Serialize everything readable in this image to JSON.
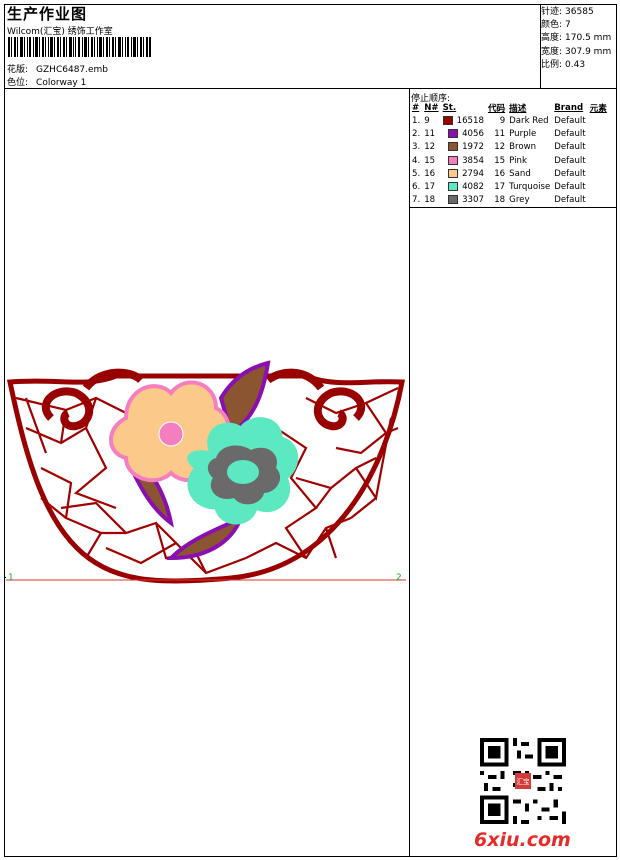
{
  "header": {
    "title": "生产作业图",
    "studio": "Wilcom(汇宝) 绣饰工作室",
    "pattern_label": "花版:",
    "pattern_value": "GZHC6487.emb",
    "colorway_label": "色位:",
    "colorway_value": "Colorway 1"
  },
  "stats": {
    "stitches_label": "针迹:",
    "stitches_value": "36585",
    "colors_label": "颜色:",
    "colors_value": "7",
    "height_label": "高度:",
    "height_value": "170.5 mm",
    "width_label": "宽度:",
    "width_value": "307.9 mm",
    "ratio_label": "比例:",
    "ratio_value": "0.43"
  },
  "stop_sequence": {
    "title": "停止顺序:",
    "headers": [
      "#",
      "N#",
      "St.",
      "代码",
      "描述",
      "Brand",
      "元素"
    ],
    "rows": [
      {
        "index": "1.",
        "n": "9",
        "color": "#990000",
        "st": "16518",
        "code": "9",
        "desc": "Dark Red",
        "brand": "Default"
      },
      {
        "index": "2.",
        "n": "11",
        "color": "#8a0fb0",
        "st": "4056",
        "code": "11",
        "desc": "Purple",
        "brand": "Default"
      },
      {
        "index": "3.",
        "n": "12",
        "color": "#8a5530",
        "st": "1972",
        "code": "12",
        "desc": "Brown",
        "brand": "Default"
      },
      {
        "index": "4.",
        "n": "15",
        "color": "#f57ec0",
        "st": "3854",
        "code": "15",
        "desc": "Pink",
        "brand": "Default"
      },
      {
        "index": "5.",
        "n": "16",
        "color": "#fbc98a",
        "st": "2794",
        "code": "16",
        "desc": "Sand",
        "brand": "Default"
      },
      {
        "index": "6.",
        "n": "17",
        "color": "#5ce8c0",
        "st": "4082",
        "code": "17",
        "desc": "Turquoise",
        "brand": "Default"
      },
      {
        "index": "7.",
        "n": "18",
        "color": "#6a6a6a",
        "st": "3307",
        "code": "18",
        "desc": "Grey",
        "brand": "Default"
      }
    ]
  },
  "markers": {
    "start": "1",
    "end": "2"
  },
  "watermark": {
    "site": "6xiu.com",
    "seal_text": "汇宝"
  },
  "icons": [
    "barcode",
    "qr-code"
  ]
}
